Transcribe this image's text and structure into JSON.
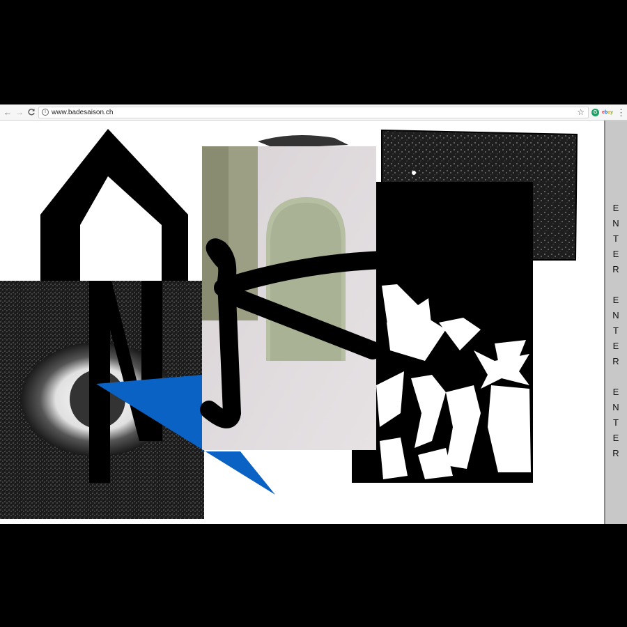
{
  "browser": {
    "url": "www.badesaison.ch",
    "nav": {
      "back": "←",
      "forward": "→",
      "reload": "C"
    },
    "bookmark_icon": "☆",
    "extensions": {
      "grammarly": "G",
      "ebay": [
        "e",
        "b",
        "a",
        "y"
      ]
    },
    "menu_icon": "⋮"
  },
  "sidebar": {
    "links": [
      "ENTER",
      "ENTER",
      "ENTER"
    ]
  },
  "colors": {
    "accent_blue": "#0a62c4",
    "sidebar_bg": "#c8c8c8"
  }
}
